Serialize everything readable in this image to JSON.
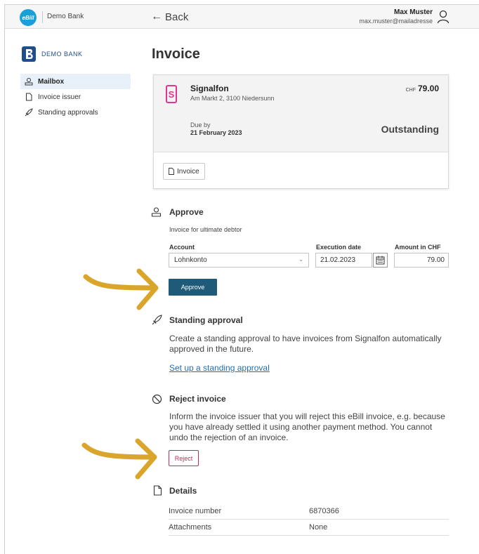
{
  "header": {
    "ebill_logo": "eBill",
    "bank_name": "Demo Bank",
    "back_label": "Back",
    "user_name": "Max Muster",
    "user_email": "max.muster@mailadresse"
  },
  "sidebar": {
    "brand": "DEMO BANK",
    "items": [
      {
        "label": "Mailbox",
        "icon": "mailbox-icon",
        "active": true
      },
      {
        "label": "Invoice issuer",
        "icon": "document-icon",
        "active": false
      },
      {
        "label": "Standing approvals",
        "icon": "rocket-icon",
        "active": false
      }
    ]
  },
  "page": {
    "title": "Invoice"
  },
  "invoice": {
    "issuer_logo": "S",
    "issuer_name": "Signalfon",
    "issuer_address": "Am Markt 2, 3100 Niedersunn",
    "currency": "CHF",
    "amount": "79.00",
    "due_label": "Due by",
    "due_date": "21 February 2023",
    "status": "Outstanding",
    "document_button": "Invoice"
  },
  "approve": {
    "title": "Approve",
    "subtitle": "Invoice for ultimate debtor",
    "account_label": "Account",
    "account_value": "Lohnkonto",
    "date_label": "Execution date",
    "date_value": "21.02.2023",
    "amount_label": "Amount in CHF",
    "amount_value": "79.00",
    "button": "Approve"
  },
  "standing": {
    "title": "Standing approval",
    "text": "Create a standing approval to have invoices from Signalfon automatically approved in the future.",
    "link": "Set up a standing approval"
  },
  "reject": {
    "title": "Reject invoice",
    "text": "Inform the invoice issuer that you will reject this eBill invoice, e.g. because you have already settled it using another payment method. You cannot undo the rejection of an invoice.",
    "button": "Reject"
  },
  "details": {
    "title": "Details",
    "rows": [
      {
        "key": "Invoice number",
        "value": "6870366"
      },
      {
        "key": "Attachments",
        "value": "None"
      }
    ]
  },
  "colors": {
    "primary": "#1f5a78",
    "reject": "#b5325a",
    "annotation_arrow": "#d9a52b",
    "ebill": "#1aa0d8",
    "issuer": "#e9338f"
  }
}
